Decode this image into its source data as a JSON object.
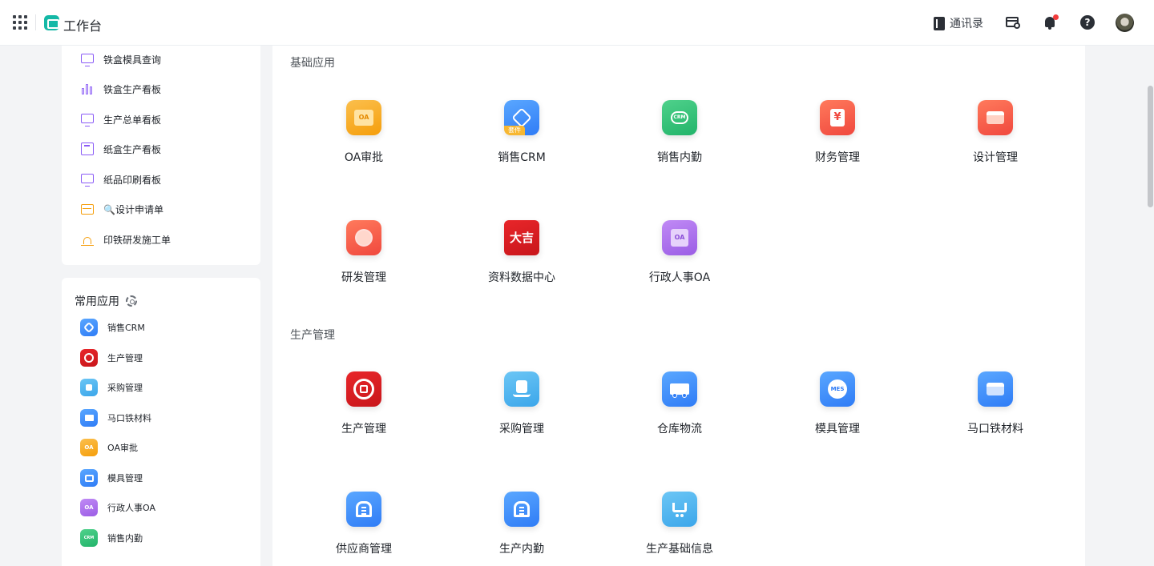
{
  "header": {
    "title": "工作台",
    "contacts_label": "通讯录",
    "help_glyph": "?"
  },
  "sidebar": {
    "menu": [
      {
        "label": "铁盒模具查询",
        "icon": "monitor-chart-icon",
        "color": "#8b5cf6"
      },
      {
        "label": "铁盒生产看板",
        "icon": "bar-chart-icon",
        "color": "#8b5cf6"
      },
      {
        "label": "生产总单看板",
        "icon": "monitor-chart-icon",
        "color": "#8b5cf6"
      },
      {
        "label": "纸盒生产看板",
        "icon": "calculator-icon",
        "color": "#8b5cf6"
      },
      {
        "label": "纸品印刷看板",
        "icon": "monitor-chart-icon",
        "color": "#8b5cf6"
      },
      {
        "label": "🔍设计申请单",
        "icon": "store-icon",
        "color": "#f59e0b"
      },
      {
        "label": "印铁研发施工单",
        "icon": "lamp-icon",
        "color": "#f59e0b"
      }
    ],
    "favorites_title": "常用应用",
    "favorites": [
      {
        "label": "销售CRM",
        "icon": "crm-suite-icon"
      },
      {
        "label": "生产管理",
        "icon": "production-logo-icon"
      },
      {
        "label": "采购管理",
        "icon": "purchase-bag-icon"
      },
      {
        "label": "马口铁材料",
        "icon": "store-icon"
      },
      {
        "label": "OA审批",
        "icon": "oa-approval-icon",
        "glyph": "OA"
      },
      {
        "label": "模具管理",
        "icon": "printer-icon"
      },
      {
        "label": "行政人事OA",
        "icon": "oa-doc-icon",
        "glyph": "OA"
      },
      {
        "label": "销售内勤",
        "icon": "crm-badge-icon",
        "glyph": "CRM"
      }
    ]
  },
  "main": {
    "sections": [
      {
        "title": "基础应用",
        "apps": [
          {
            "label": "OA审批",
            "icon": "oa-approval-icon",
            "glyph": "OA"
          },
          {
            "label": "销售CRM",
            "icon": "crm-suite-icon",
            "badge": "套件"
          },
          {
            "label": "销售内勤",
            "icon": "crm-badge-icon",
            "glyph": "CRM"
          },
          {
            "label": "财务管理",
            "icon": "yen-receipt-icon",
            "glyph": "¥"
          },
          {
            "label": "设计管理",
            "icon": "store-icon"
          },
          {
            "label": "研发管理",
            "icon": "planet-icon"
          },
          {
            "label": "资料数据中心",
            "icon": "calligraphy-logo-icon",
            "glyph": "大吉"
          },
          {
            "label": "行政人事OA",
            "icon": "oa-doc-icon",
            "glyph": "OA"
          }
        ]
      },
      {
        "title": "生产管理",
        "apps": [
          {
            "label": "生产管理",
            "icon": "production-logo-icon"
          },
          {
            "label": "采购管理",
            "icon": "purchase-bag-icon"
          },
          {
            "label": "仓库物流",
            "icon": "truck-icon"
          },
          {
            "label": "模具管理",
            "icon": "mes-gear-icon",
            "glyph": "MES"
          },
          {
            "label": "马口铁材料",
            "icon": "store-icon"
          },
          {
            "label": "供应商管理",
            "icon": "warehouse-icon"
          },
          {
            "label": "生产内勤",
            "icon": "warehouse-icon"
          },
          {
            "label": "生产基础信息",
            "icon": "cart-icon"
          }
        ]
      }
    ]
  }
}
